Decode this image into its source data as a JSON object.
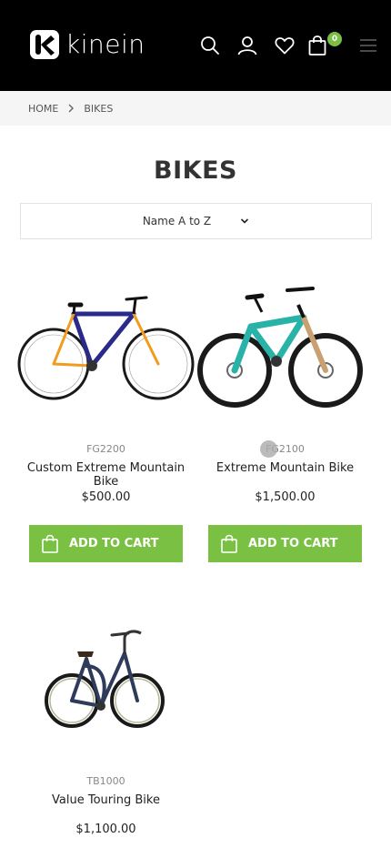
{
  "brand": {
    "logo_text": "kinein",
    "accent": "#7ac143",
    "header_bg": "#000000"
  },
  "header": {
    "icons": [
      "search-icon",
      "user-icon",
      "heart-icon",
      "shopping-bag-icon",
      "hamburger-menu-icon"
    ],
    "cart_count": "0"
  },
  "breadcrumb": {
    "home": "HOME",
    "current": "BIKES"
  },
  "page": {
    "title": "BIKES"
  },
  "sort": {
    "selected": "Name A to Z"
  },
  "products": [
    {
      "sku": "FG2200",
      "name": "Custom Extreme Mountain Bike",
      "price": "$500.00",
      "button": "ADD TO CART"
    },
    {
      "sku": "FG2100",
      "name": "Extreme Mountain Bike",
      "price": "$1,500.00",
      "button": "ADD TO CART"
    },
    {
      "sku": "TB1000",
      "name": "Value Touring Bike",
      "price": "$1,100.00"
    }
  ]
}
